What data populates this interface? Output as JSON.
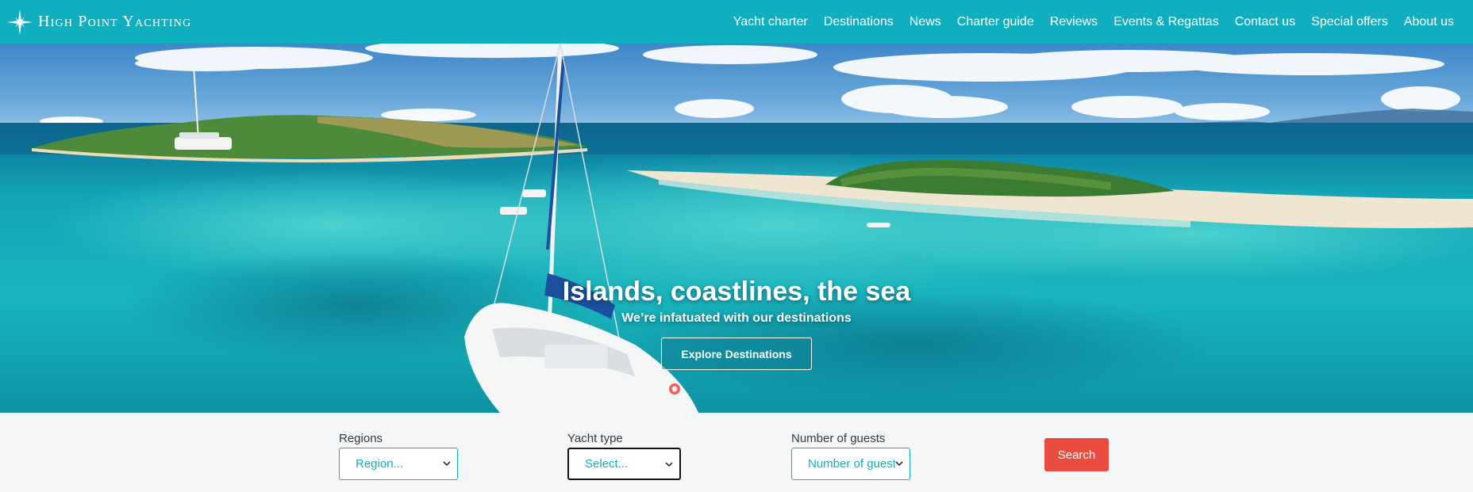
{
  "brand": {
    "name": "High Point Yachting",
    "logo_icon": "compass-star-icon"
  },
  "nav": {
    "items": [
      {
        "label": "Yacht charter"
      },
      {
        "label": "Destinations"
      },
      {
        "label": "News"
      },
      {
        "label": "Charter guide"
      },
      {
        "label": "Reviews"
      },
      {
        "label": "Events & Regattas"
      },
      {
        "label": "Contact us"
      },
      {
        "label": "Special offers"
      },
      {
        "label": "About us"
      }
    ]
  },
  "hero": {
    "title": "Islands, coastlines, the sea",
    "subtitle": "We’re infatuated with our destinations",
    "button_label": "Explore Destinations"
  },
  "search": {
    "regions": {
      "label": "Regions",
      "value": "Region..."
    },
    "yacht_type": {
      "label": "Yacht type",
      "value": "Select..."
    },
    "guests": {
      "label": "Number of guests",
      "value": "Number of guests"
    },
    "button_label": "Search"
  },
  "colors": {
    "nav_bg": "#10afc0",
    "accent": "#10afc0",
    "search_button": "#ea4c3f",
    "page_bg": "#f4f6f8"
  }
}
